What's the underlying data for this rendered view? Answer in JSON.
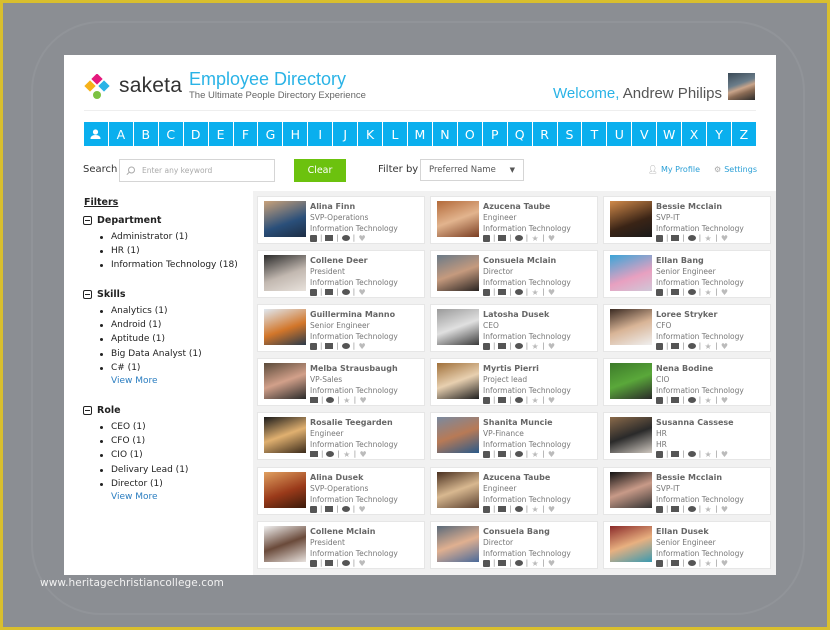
{
  "app": {
    "brand": "saketa",
    "title": "Employee Directory",
    "subtitle": "The Ultimate People Directory Experience",
    "welcome_label": "Welcome,",
    "user_name": "Andrew Philips",
    "colors": {
      "accent": "#0aafee",
      "title": "#2ab3e6",
      "clear": "#6cc20e",
      "link": "#2a9fd6"
    }
  },
  "alphabet": [
    "A",
    "B",
    "C",
    "D",
    "E",
    "F",
    "G",
    "H",
    "I",
    "J",
    "K",
    "L",
    "M",
    "N",
    "O",
    "P",
    "Q",
    "R",
    "S",
    "T",
    "U",
    "V",
    "W",
    "X",
    "Y",
    "Z"
  ],
  "search": {
    "label": "Search",
    "placeholder": "Enter any keyword",
    "clear_label": "Clear",
    "filter_by_label": "Filter by",
    "filter_by_value": "Preferred Name"
  },
  "toplinks": {
    "profile": "My Profile",
    "settings": "Settings"
  },
  "filters": {
    "title": "Filters",
    "groups": [
      {
        "name": "Department",
        "items": [
          "Administrator (1)",
          "HR (1)",
          "Information Technology (18)"
        ],
        "more": ""
      },
      {
        "name": "Skills",
        "items": [
          "Analytics (1)",
          "Android (1)",
          "Aptitude (1)",
          "Big Data Analyst (1)",
          "C# (1)"
        ],
        "more": "View More"
      },
      {
        "name": "Role",
        "items": [
          "CEO (1)",
          "CFO (1)",
          "CIO (1)",
          "Delivary Lead (1)",
          "Director (1)"
        ],
        "more": "View More"
      }
    ]
  },
  "employees": [
    {
      "name": "Alina Finn",
      "role": "SVP-Operations",
      "dept": "Information Technology",
      "actions": [
        "phone",
        "mail",
        "chat",
        "heart"
      ]
    },
    {
      "name": "Azucena Taube",
      "role": "Engineer",
      "dept": "Information Technology",
      "actions": [
        "phone",
        "mail",
        "chat",
        "star",
        "heart"
      ]
    },
    {
      "name": "Bessie Mcclain",
      "role": "SVP-IT",
      "dept": "Information Technology",
      "actions": [
        "phone",
        "mail",
        "chat",
        "star",
        "heart"
      ]
    },
    {
      "name": "Collene Deer",
      "role": "President",
      "dept": "Information Technology",
      "actions": [
        "phone",
        "mail",
        "chat",
        "heart"
      ]
    },
    {
      "name": "Consuela Mclain",
      "role": "Director",
      "dept": "Information Technology",
      "actions": [
        "phone",
        "mail",
        "chat",
        "star",
        "heart"
      ]
    },
    {
      "name": "Ellan Bang",
      "role": "Senior Engineer",
      "dept": "Information Technology",
      "actions": [
        "phone",
        "mail",
        "chat",
        "star",
        "heart"
      ]
    },
    {
      "name": "Guillermina Manno",
      "role": "Senior Engineer",
      "dept": "Information Technology",
      "actions": [
        "phone",
        "mail",
        "chat",
        "heart"
      ]
    },
    {
      "name": "Latosha Dusek",
      "role": "CEO",
      "dept": "Information Technology",
      "actions": [
        "phone",
        "mail",
        "chat",
        "star",
        "heart"
      ]
    },
    {
      "name": "Loree Stryker",
      "role": "CFO",
      "dept": "Information Technology",
      "actions": [
        "phone",
        "mail",
        "chat",
        "star",
        "heart"
      ]
    },
    {
      "name": "Melba Strausbaugh",
      "role": "VP-Sales",
      "dept": "Information Technology",
      "actions": [
        "mail",
        "chat",
        "star",
        "heart"
      ]
    },
    {
      "name": "Myrtis Pierri",
      "role": "Project lead",
      "dept": "Information Technology",
      "actions": [
        "phone",
        "mail",
        "chat",
        "star",
        "heart"
      ]
    },
    {
      "name": "Nena Bodine",
      "role": "CIO",
      "dept": "Information Technology",
      "actions": [
        "phone",
        "mail",
        "chat",
        "star",
        "heart"
      ]
    },
    {
      "name": "Rosalie Teegarden",
      "role": "Engineer",
      "dept": "Information Technology",
      "actions": [
        "mail",
        "chat",
        "star",
        "heart"
      ]
    },
    {
      "name": "Shanita Muncie",
      "role": "VP-Finance",
      "dept": "Information Technology",
      "actions": [
        "phone",
        "mail",
        "chat",
        "star",
        "heart"
      ]
    },
    {
      "name": "Susanna Cassese",
      "role": "HR",
      "dept": "HR",
      "actions": [
        "phone",
        "mail",
        "chat",
        "star",
        "heart"
      ]
    },
    {
      "name": "Alina Dusek",
      "role": "SVP-Operations",
      "dept": "Information Technology",
      "actions": [
        "phone",
        "mail",
        "chat",
        "heart"
      ]
    },
    {
      "name": "Azucena Taube",
      "role": "Engineer",
      "dept": "Information Technology",
      "actions": [
        "phone",
        "mail",
        "chat",
        "star",
        "heart"
      ]
    },
    {
      "name": "Bessie Mcclain",
      "role": "SVP-IT",
      "dept": "Information Technology",
      "actions": [
        "phone",
        "mail",
        "chat",
        "star",
        "heart"
      ]
    },
    {
      "name": "Collene Mclain",
      "role": "President",
      "dept": "Information Technology",
      "actions": [
        "phone",
        "mail",
        "chat",
        "heart"
      ]
    },
    {
      "name": "Consuela Bang",
      "role": "Director",
      "dept": "Information Technology",
      "actions": [
        "phone",
        "mail",
        "chat",
        "star",
        "heart"
      ]
    },
    {
      "name": "Ellan Dusek",
      "role": "Senior Engineer",
      "dept": "Information Technology",
      "actions": [
        "phone",
        "mail",
        "chat",
        "star",
        "heart"
      ]
    }
  ],
  "watermark": "www.heritagechristiancollege.com"
}
